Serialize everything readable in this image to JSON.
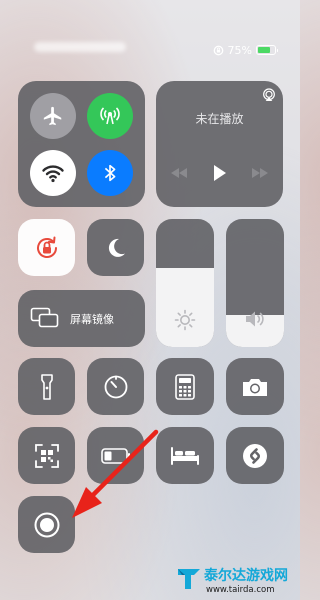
{
  "status_bar": {
    "battery_text": "75%",
    "battery_level": 0.75,
    "icons": [
      "orientation-lock-icon",
      "battery-charging-icon"
    ]
  },
  "connectivity": {
    "buttons": [
      {
        "name": "airplane-mode",
        "state": "off",
        "icon": "airplane-icon"
      },
      {
        "name": "cellular-data",
        "state": "on",
        "icon": "antenna-icon",
        "color": "#34c759"
      },
      {
        "name": "wifi",
        "state": "on",
        "icon": "wifi-icon"
      },
      {
        "name": "bluetooth",
        "state": "on",
        "icon": "bluetooth-icon",
        "color": "#0a7cff"
      }
    ]
  },
  "now_playing": {
    "title": "未在播放",
    "controls": [
      "airplay-icon",
      "rewind-icon",
      "play-icon",
      "fast-forward-icon"
    ]
  },
  "toggles": {
    "orientation_lock": {
      "state": "on",
      "icon": "rotation-lock-icon",
      "color": "#e84a3c"
    },
    "do_not_disturb": {
      "state": "off",
      "icon": "moon-icon"
    }
  },
  "screen_mirroring": {
    "label": "屏幕镜像",
    "icon": "screen-mirroring-icon"
  },
  "brightness": {
    "level": 0.62,
    "icon": "sun-icon"
  },
  "volume": {
    "level": 0.25,
    "icon": "speaker-icon"
  },
  "shortcuts": [
    {
      "name": "flashlight",
      "icon": "flashlight-icon"
    },
    {
      "name": "timer",
      "icon": "timer-icon"
    },
    {
      "name": "calculator",
      "icon": "calculator-icon"
    },
    {
      "name": "camera",
      "icon": "camera-icon"
    },
    {
      "name": "qr-scanner",
      "icon": "qr-code-icon"
    },
    {
      "name": "low-power-mode",
      "icon": "battery-icon"
    },
    {
      "name": "sleep-mode",
      "icon": "bed-icon"
    },
    {
      "name": "shazam",
      "icon": "shazam-icon"
    },
    {
      "name": "screen-recording",
      "icon": "record-icon"
    }
  ],
  "annotation": {
    "arrow_color": "#e8231a"
  },
  "watermark": {
    "text": "泰尔达游戏网",
    "url": "www.tairda.com"
  }
}
